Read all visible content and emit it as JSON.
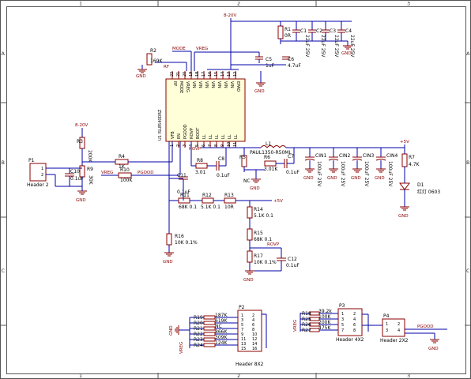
{
  "frame": {
    "cols": [
      "1",
      "2",
      "3"
    ],
    "rows": [
      "A",
      "B",
      "C"
    ]
  },
  "nets": {
    "vin_top": "8-20V",
    "vin_left": "8-20V",
    "mode": "MODE",
    "rf": "RF",
    "vreg_top": "VREG",
    "vreg_mid": "VREG",
    "pgood_mid": "PGOOD",
    "pgood_right": "PGOOD",
    "rovp1": "ROVP",
    "rovp2": "ROVP",
    "p5v_out": "+5V",
    "p5v_div": "+5V",
    "gnd": "GND",
    "vreg_p2": "VREG",
    "vreg_p3": "VREG",
    "nc": "NC",
    "nc_p2": "NC"
  },
  "ic": {
    "part": "U1 ISL8540DRZ",
    "pins_top": [
      "RF",
      "MODE",
      "VREG",
      "VIN",
      "VIN",
      "VIN",
      "VIN",
      "VIN",
      "VIN",
      "VIN",
      "EPAD"
    ],
    "pins_top_num": [
      "22",
      "21",
      "20",
      "19",
      "18",
      "17",
      "16",
      "15",
      "14",
      "13",
      "12"
    ],
    "pins_bottom": [
      "VFB",
      "EN",
      "PGOOD",
      "ROVP",
      "BOOT",
      "LL",
      "LL",
      "LL",
      "LL",
      "LL",
      "LL"
    ],
    "pins_bottom_num": [
      "1",
      "2",
      "3",
      "4",
      "5",
      "6",
      "7",
      "8",
      "9",
      "10",
      "11"
    ]
  },
  "parts": {
    "R1": {
      "ref": "R1",
      "val": "0R"
    },
    "R2": {
      "ref": "R2",
      "val": "169K"
    },
    "R3": {
      "ref": "R3",
      "val": "200K"
    },
    "R4": {
      "ref": "R4",
      "val": "1K"
    },
    "R5": {
      "ref": "R5",
      "val": ""
    },
    "R6": {
      "ref": "R6",
      "val": "3.01K"
    },
    "R7": {
      "ref": "R7",
      "val": "4.7K"
    },
    "R8": {
      "ref": "R8",
      "val": "3.01"
    },
    "R9": {
      "ref": "R9",
      "val": "30K"
    },
    "R10": {
      "ref": "R10",
      "val": "100K"
    },
    "R11": {
      "ref": "R11",
      "val": "68K 0.1"
    },
    "R12": {
      "ref": "R12",
      "val": "5.1K 0.1"
    },
    "R13": {
      "ref": "R13",
      "val": "10R"
    },
    "R14": {
      "ref": "R14",
      "val": "5.1K 0.1"
    },
    "R15": {
      "ref": "R15",
      "val": "68K 0.1"
    },
    "R16": {
      "ref": "R16",
      "val": "10K 0.1%"
    },
    "R17": {
      "ref": "R17",
      "val": "10K 0.1%"
    },
    "C1": {
      "ref": "C1",
      "val": "22uF 25V"
    },
    "C2": {
      "ref": "C2",
      "val": "22uF 25V"
    },
    "C3": {
      "ref": "C3",
      "val": "22uF 25V"
    },
    "C4": {
      "ref": "C4",
      "val": "22uF 25V"
    },
    "C5": {
      "ref": "C5",
      "val": "1uF"
    },
    "C6": {
      "ref": "C6",
      "val": "4.7uF"
    },
    "C7": {
      "ref": "C7",
      "val": "0.1uF"
    },
    "C8": {
      "ref": "C8",
      "val": "0.1uF"
    },
    "C10": {
      "ref": "C10",
      "val": "0.1uF"
    },
    "C11": {
      "ref": "C11",
      "val": "0.1uF"
    },
    "C12": {
      "ref": "C12",
      "val": "0.1uF"
    },
    "L1": {
      "ref": "L1",
      "val": "PAUL1350-R50ML"
    },
    "CIN1": {
      "ref": "CIN1",
      "val": "100uF 25V"
    },
    "CIN2": {
      "ref": "CIN2",
      "val": "100uF 25V"
    },
    "CIN3": {
      "ref": "CIN3",
      "val": "100uF 25V"
    },
    "CIN4": {
      "ref": "CIN4",
      "val": "100uF 25V"
    },
    "D1": {
      "ref": "D1",
      "val": "红灯 0603"
    },
    "P1": {
      "ref": "P1",
      "val": "Header 2"
    },
    "P2": {
      "ref": "P2",
      "val": "Header 8X2"
    },
    "P3": {
      "ref": "P3",
      "val": "Header 4X2"
    },
    "P4": {
      "ref": "P4",
      "val": "Header 2X2"
    }
  },
  "p2_resistors": [
    {
      "ref": "R19",
      "val": "187K"
    },
    {
      "ref": "R20",
      "val": "619K"
    },
    {
      "ref": "R21",
      "val": "NC"
    },
    {
      "ref": "R22",
      "val": "866K"
    },
    {
      "ref": "R23",
      "val": "309K"
    },
    {
      "ref": "R24",
      "val": "124K"
    }
  ],
  "p3_resistors": [
    {
      "ref": "R18",
      "val": "39.2k"
    },
    {
      "ref": "R25",
      "val": "100K"
    },
    {
      "ref": "R26",
      "val": "200K"
    },
    {
      "ref": "R27",
      "val": "475K"
    }
  ],
  "headers": {
    "p1_pins": [
      "1",
      "2"
    ],
    "p2_pins_left": [
      "1",
      "3",
      "5",
      "7",
      "9",
      "11",
      "13",
      "15"
    ],
    "p2_pins_right": [
      "2",
      "4",
      "6",
      "8",
      "10",
      "12",
      "14",
      "16"
    ],
    "p3_pins_left": [
      "1",
      "3",
      "5",
      "7"
    ],
    "p3_pins_right": [
      "2",
      "4",
      "6",
      "8"
    ],
    "p4_pins_left": [
      "1",
      "3"
    ],
    "p4_pins_right": [
      "2",
      "4"
    ]
  }
}
